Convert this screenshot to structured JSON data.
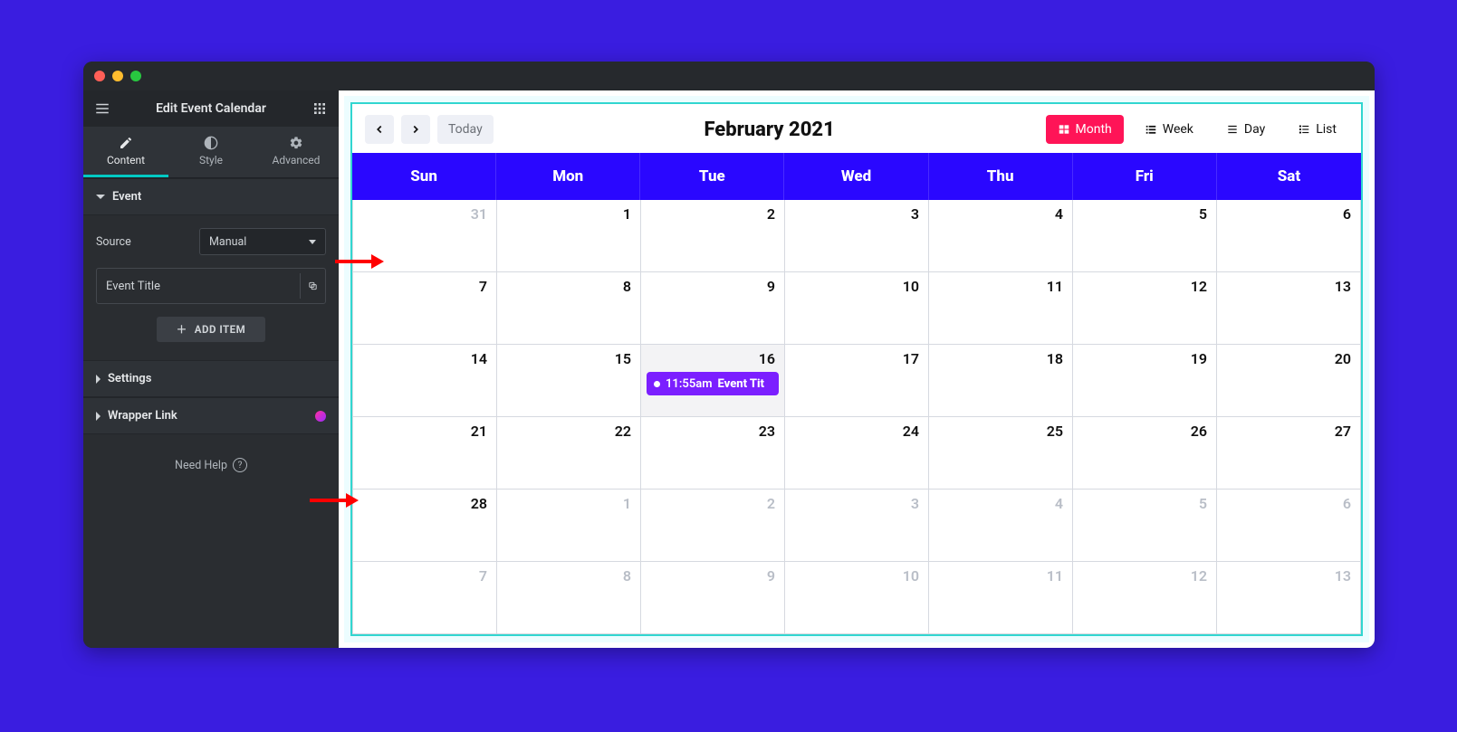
{
  "window": {
    "title": "Edit Event Calendar"
  },
  "tabs": {
    "content": "Content",
    "style": "Style",
    "advanced": "Advanced"
  },
  "section_event": {
    "title": "Event",
    "source_label": "Source",
    "source_value": "Manual",
    "item_title": "Event Title",
    "add_item": "ADD ITEM"
  },
  "section_settings": {
    "title": "Settings"
  },
  "section_wrapper": {
    "title": "Wrapper Link"
  },
  "help": {
    "label": "Need Help"
  },
  "calendar": {
    "title": "February 2021",
    "today_label": "Today",
    "views": {
      "month": "Month",
      "week": "Week",
      "day": "Day",
      "list": "List"
    },
    "day_headers": [
      "Sun",
      "Mon",
      "Tue",
      "Wed",
      "Thu",
      "Fri",
      "Sat"
    ],
    "weeks": [
      [
        {
          "n": "31",
          "dim": true
        },
        {
          "n": "1"
        },
        {
          "n": "2"
        },
        {
          "n": "3"
        },
        {
          "n": "4"
        },
        {
          "n": "5"
        },
        {
          "n": "6"
        }
      ],
      [
        {
          "n": "7"
        },
        {
          "n": "8"
        },
        {
          "n": "9"
        },
        {
          "n": "10"
        },
        {
          "n": "11"
        },
        {
          "n": "12"
        },
        {
          "n": "13"
        }
      ],
      [
        {
          "n": "14"
        },
        {
          "n": "15"
        },
        {
          "n": "16",
          "selected": true,
          "event": {
            "time": "11:55am",
            "title": "Event Tit"
          }
        },
        {
          "n": "17"
        },
        {
          "n": "18"
        },
        {
          "n": "19"
        },
        {
          "n": "20"
        }
      ],
      [
        {
          "n": "21"
        },
        {
          "n": "22"
        },
        {
          "n": "23"
        },
        {
          "n": "24"
        },
        {
          "n": "25"
        },
        {
          "n": "26"
        },
        {
          "n": "27"
        }
      ],
      [
        {
          "n": "28"
        },
        {
          "n": "1",
          "dim": true
        },
        {
          "n": "2",
          "dim": true
        },
        {
          "n": "3",
          "dim": true
        },
        {
          "n": "4",
          "dim": true
        },
        {
          "n": "5",
          "dim": true
        },
        {
          "n": "6",
          "dim": true
        }
      ],
      [
        {
          "n": "7",
          "dim": true
        },
        {
          "n": "8",
          "dim": true
        },
        {
          "n": "9",
          "dim": true
        },
        {
          "n": "10",
          "dim": true
        },
        {
          "n": "11",
          "dim": true
        },
        {
          "n": "12",
          "dim": true
        },
        {
          "n": "13",
          "dim": true
        }
      ]
    ]
  },
  "colors": {
    "accent": "#ff1457",
    "brand_blue": "#2a07ff",
    "event_purple": "#7b1fff",
    "teal": "#31d6d0"
  }
}
